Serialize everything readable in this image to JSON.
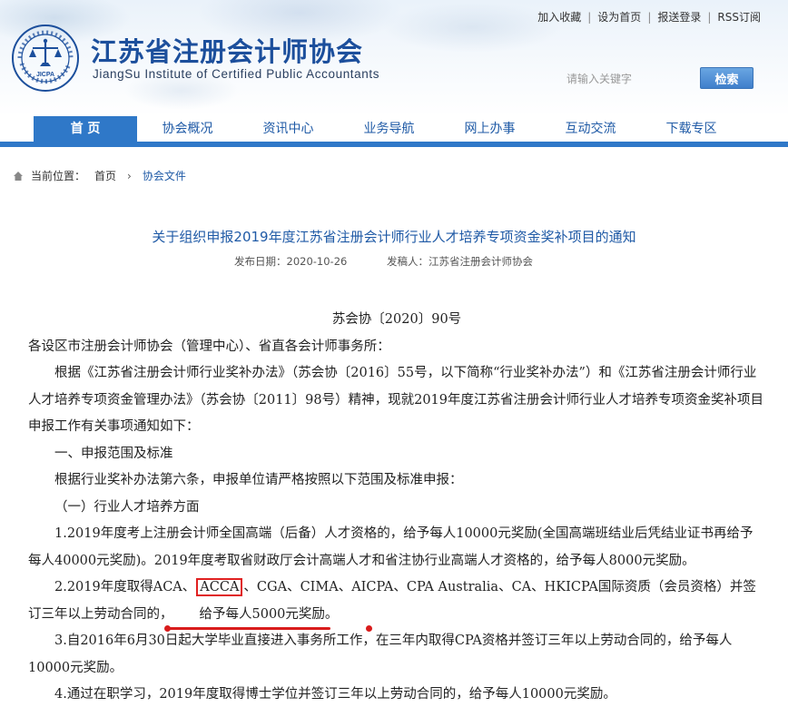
{
  "header": {
    "top_links": [
      "加入收藏",
      "设为首页",
      "报送登录",
      "RSS订阅"
    ],
    "org_name_cn": "江苏省注册会计师协会",
    "org_name_en": "JiangSu Institute of Certified Public Accountants",
    "seal_text": "JICPA",
    "search": {
      "placeholder": "请输入关键字",
      "button": "检索"
    }
  },
  "nav": {
    "items": [
      "首 页",
      "协会概况",
      "资讯中心",
      "业务导航",
      "网上办事",
      "互动交流",
      "下载专区"
    ],
    "active_index": 0
  },
  "breadcrumb": {
    "label": "当前位置：",
    "home": "首页",
    "current": "协会文件"
  },
  "article": {
    "title": "关于组织申报2019年度江苏省注册会计师行业人才培养专项资金奖补项目的通知",
    "date_label": "发布日期：2020-10-26",
    "author_label": "发稿人：江苏省注册会计师协会",
    "doc_number": "苏会协〔2020〕90号",
    "salutation": "各设区市注册会计师协会（管理中心）、省直各会计师事务所：",
    "intro": "根据《江苏省注册会计师行业奖补办法》（苏会协〔2016〕55号，以下简称“行业奖补办法”）和《江苏省注册会计师行业人才培养专项资金管理办法》（苏会协〔2011〕98号）精神，现就2019年度江苏省注册会计师行业人才培养专项资金奖补项目申报工作有关事项通知如下：",
    "section1": "一、申报范围及标准",
    "section1_intro": "根据行业奖补办法第六条，申报单位请严格按照以下范围及标准申报：",
    "sub1": "（一）行业人才培养方面",
    "item1": "1.2019年度考上注册会计师全国高端（后备）人才资格的，给予每人10000元奖励(全国高端班结业后凭结业证书再给予每人40000元奖励)。2019年度考取省财政厅会计高端人才和省注协行业高端人才资格的，给予每人8000元奖励。",
    "item2_pre": "2.2019年度取得ACA、",
    "item2_boxed": "ACCA",
    "item2_mid": "、CGA、CIMA、AICPA、CPA Australia、CA、HKICPA国际资质（会员资格）并签订三年以上劳动合同的，",
    "item2_underlined": "给予每人5000元奖励",
    "item2_post": "。",
    "item3": "3.自2016年6月30日起大学毕业直接进入事务所工作，在三年内取得CPA资格并签订三年以上劳动合同的，给予每人10000元奖励。",
    "item4": "4.通过在职学习，2019年度取得博士学位并签订三年以上劳动合同的，给予每人10000元奖励。"
  },
  "colors": {
    "brand_blue": "#1c4f9c",
    "nav_blue": "#2f78c8",
    "highlight_red": "#e02020"
  }
}
